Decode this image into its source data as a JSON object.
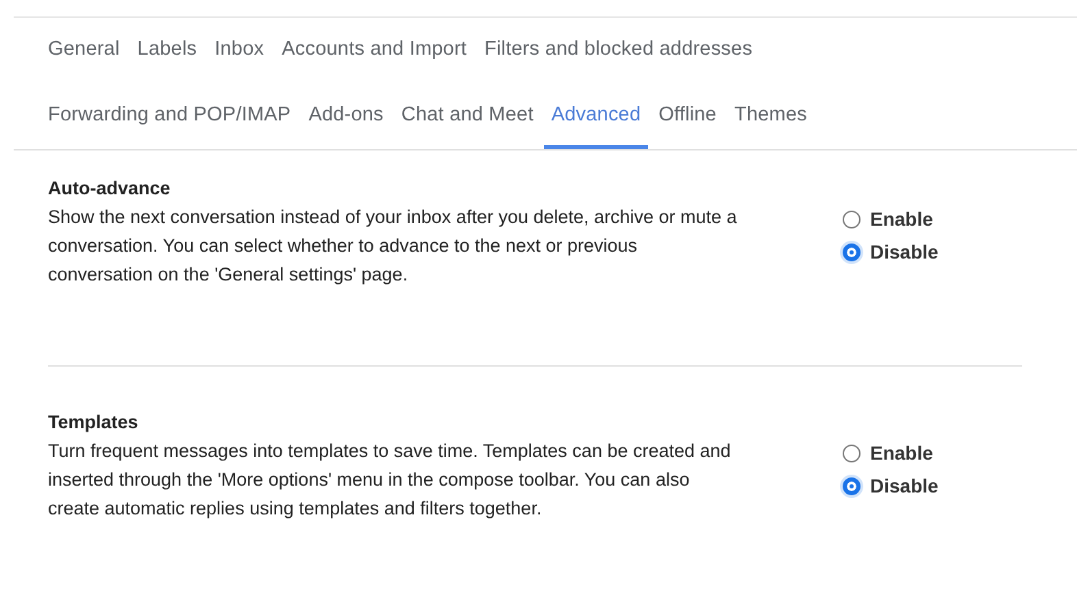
{
  "tabs": [
    [
      {
        "label": "General",
        "selected": false
      },
      {
        "label": "Labels",
        "selected": false
      },
      {
        "label": "Inbox",
        "selected": false
      },
      {
        "label": "Accounts and Import",
        "selected": false
      },
      {
        "label": "Filters and blocked addresses",
        "selected": false
      }
    ],
    [
      {
        "label": "Forwarding and POP/IMAP",
        "selected": false
      },
      {
        "label": "Add-ons",
        "selected": false
      },
      {
        "label": "Chat and Meet",
        "selected": false
      },
      {
        "label": "Advanced",
        "selected": true
      },
      {
        "label": "Offline",
        "selected": false
      },
      {
        "label": "Themes",
        "selected": false
      }
    ]
  ],
  "sections": [
    {
      "title": "Auto-advance",
      "description": "Show the next conversation instead of your inbox after you delete, archive or mute a conversation. You can select whether to advance to the next or previous conversation on the 'General settings' page.",
      "options": [
        {
          "label": "Enable",
          "selected": false
        },
        {
          "label": "Disable",
          "selected": true
        }
      ]
    },
    {
      "title": "Templates",
      "description": "Turn frequent messages into templates to save time. Templates can be created and inserted through the 'More options' menu in the compose toolbar. You can also create automatic replies using templates and filters together.",
      "options": [
        {
          "label": "Enable",
          "selected": false
        },
        {
          "label": "Disable",
          "selected": true
        }
      ]
    }
  ]
}
